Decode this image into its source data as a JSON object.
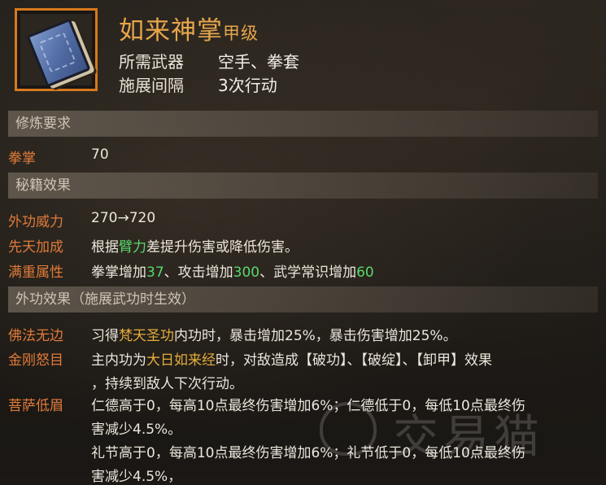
{
  "skill": {
    "icon": "blue-book-icon",
    "name": "如来神掌",
    "grade": "甲级",
    "weapon_label": "所需武器",
    "weapon_value": "空手、拳套",
    "interval_label": "施展间隔",
    "interval_value": "3次行动"
  },
  "sections": {
    "training": "修炼要求",
    "effects": "秘籍效果",
    "external": "外功效果（施展武功时生效）"
  },
  "training": {
    "label": "拳掌",
    "value": "70"
  },
  "effects": {
    "power_label": "外功威力",
    "power_value": "270→720",
    "innate_label": "先天加成",
    "innate_pre": "根据",
    "innate_hl": "臂力",
    "innate_post": "差提升伤害或降低伤害。",
    "full_label": "满重属性",
    "full_1": "拳掌增加",
    "full_1v": "37",
    "full_2": "、攻击增加",
    "full_2v": "300",
    "full_3": "、武学常识增加",
    "full_3v": "60"
  },
  "external": {
    "e1_label": "佛法无边",
    "e1_pre": "习得",
    "e1_hl": "梵天圣功",
    "e1_post": "内功时，暴击增加25%，暴击伤害增加25%。",
    "e2_label": "金刚怒目",
    "e2_pre": "主内功为",
    "e2_hl": "大日如来经",
    "e2_post": "时，对敌造成【破功】、【破绽】、【卸甲】效果",
    "e2_line2": "，持续到敌人下次行动。",
    "e3_label": "菩萨低眉",
    "e3_l1": "仁德高于0，每高10点最终伤害增加6%；仁德低于0，每低10点最终伤",
    "e3_l2": "害减少4.5%。",
    "e3_l3": "礼节高于0，每高10点最终伤害增加6%；礼节低于0，每低10点最终伤",
    "e3_l4": "害减少4.5%，"
  },
  "watermark": {
    "text": "交易猫",
    "icon": "cat-logo-icon"
  },
  "colors": {
    "title": "#e7a64b",
    "label": "#e07b3a",
    "highlight_yellow": "#e3ad3c",
    "highlight_green": "#59d86c",
    "frame": "#d67a1e"
  }
}
